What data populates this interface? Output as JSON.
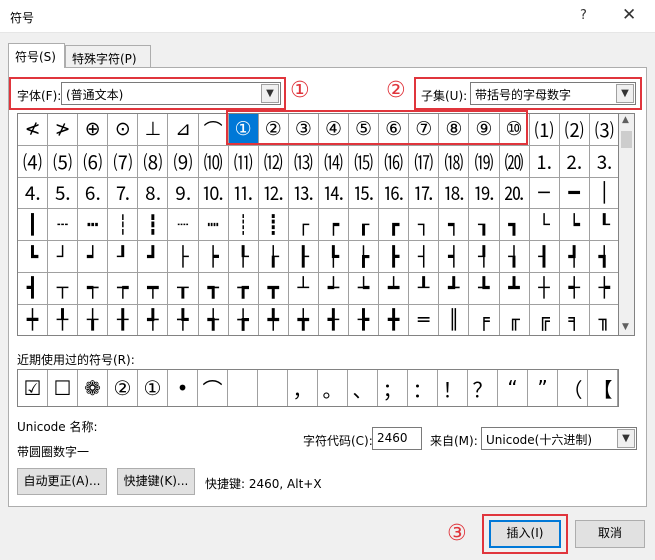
{
  "window": {
    "title": "符号",
    "help_icon": "?",
    "close_icon": "✕"
  },
  "tabs": [
    {
      "label": "符号(S)"
    },
    {
      "label": "特殊字符(P)"
    }
  ],
  "font": {
    "label": "字体(F):",
    "value": "(普通文本)"
  },
  "subset": {
    "label": "子集(U):",
    "value": "带括号的字母数字"
  },
  "annotations": {
    "one": "①",
    "two": "②",
    "three": "③"
  },
  "grid": {
    "rows": [
      [
        "≮",
        "≯",
        "⊕",
        "⊙",
        "⊥",
        "⊿",
        "⌒",
        "①",
        "②",
        "③",
        "④",
        "⑤",
        "⑥",
        "⑦",
        "⑧",
        "⑨",
        "⑩",
        "⑴",
        "⑵",
        "⑶"
      ],
      [
        "⑷",
        "⑸",
        "⑹",
        "⑺",
        "⑻",
        "⑼",
        "⑽",
        "⑾",
        "⑿",
        "⒀",
        "⒁",
        "⒂",
        "⒃",
        "⒄",
        "⒅",
        "⒆",
        "⒇",
        "⒈",
        "⒉",
        "⒊"
      ],
      [
        "⒋",
        "⒌",
        "⒍",
        "⒎",
        "⒏",
        "⒐",
        "⒑",
        "⒒",
        "⒓",
        "⒔",
        "⒕",
        "⒖",
        "⒗",
        "⒘",
        "⒙",
        "⒚",
        "⒛",
        "─",
        "━",
        "│"
      ],
      [
        "┃",
        "┄",
        "┅",
        "┆",
        "┇",
        "┈",
        "┉",
        "┊",
        "┋",
        "┌",
        "┍",
        "┎",
        "┏",
        "┐",
        "┑",
        "┒",
        "┓",
        "└",
        "┕",
        "┖"
      ],
      [
        "┗",
        "┘",
        "┙",
        "┚",
        "┛",
        "├",
        "┝",
        "┞",
        "┟",
        "┠",
        "┡",
        "┢",
        "┣",
        "┤",
        "┥",
        "┦",
        "┧",
        "┨",
        "┩",
        "┪"
      ],
      [
        "┫",
        "┬",
        "┭",
        "┮",
        "┯",
        "┰",
        "┱",
        "┲",
        "┳",
        "┴",
        "┵",
        "┶",
        "┷",
        "┸",
        "┹",
        "┺",
        "┻",
        "┼",
        "┽",
        "┾"
      ],
      [
        "┿",
        "╀",
        "╁",
        "╂",
        "╃",
        "╄",
        "╅",
        "╆",
        "╇",
        "╈",
        "╉",
        "╊",
        "╋",
        "═",
        "║",
        "╒",
        "╓",
        "╔",
        "╕",
        "╖"
      ]
    ],
    "selected": "①"
  },
  "recent": {
    "label": "近期使用过的符号(R):",
    "items": [
      "☑",
      "☐",
      "❁",
      "②",
      "①",
      "•",
      "⌒",
      "",
      "",
      "，",
      "。",
      "、",
      "；",
      "：",
      "！",
      "？",
      "“",
      "”",
      "（",
      "【"
    ]
  },
  "unicode_name": {
    "label": "Unicode 名称:",
    "value": "带圆圈数字一"
  },
  "char_code": {
    "label": "字符代码(C):",
    "value": "2460"
  },
  "from": {
    "label": "来自(M):",
    "value": "Unicode(十六进制)"
  },
  "buttons": {
    "autocorrect": "自动更正(A)...",
    "shortcut": "快捷键(K)...",
    "shortcut_info": "快捷键: 2460, Alt+X",
    "insert": "插入(I)",
    "cancel": "取消"
  },
  "colors": {
    "highlight": "#e0353c",
    "selection": "#0078d7"
  }
}
